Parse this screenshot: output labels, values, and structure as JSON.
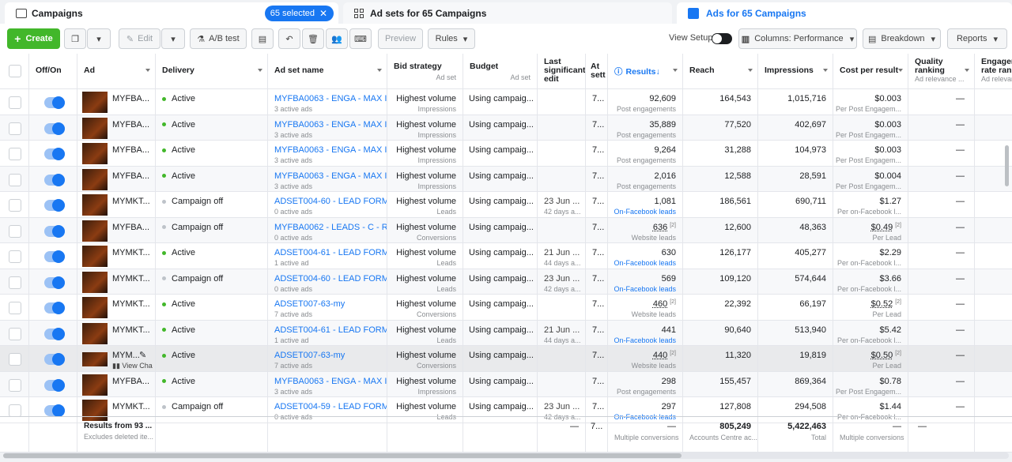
{
  "tabs": {
    "campaigns": "Campaigns",
    "selected_badge": "65 selected",
    "adsets": "Ad sets for 65 Campaigns",
    "ads": "Ads for 65 Campaigns"
  },
  "toolbar": {
    "create": "Create",
    "edit": "Edit",
    "ab_test": "A/B test",
    "preview": "Preview",
    "rules": "Rules",
    "view_setup": "View Setup",
    "columns": "Columns: Performance",
    "breakdown": "Breakdown",
    "reports": "Reports"
  },
  "headers": {
    "offon": "Off/On",
    "ad": "Ad",
    "delivery": "Delivery",
    "adset": "Ad set name",
    "bid": "Bid strategy",
    "bid_sub": "Ad set",
    "budget": "Budget",
    "budget_sub": "Ad set",
    "last1": "Last",
    "last2": "significant",
    "last3": "edit",
    "att1": "At",
    "att2": "sett",
    "results": "Results",
    "reach": "Reach",
    "impressions": "Impressions",
    "cpr": "Cost per result",
    "quality1": "Quality",
    "quality2": "ranking",
    "quality_sub": "Ad relevance ...",
    "eng1": "Engagem",
    "eng2": "rate rank",
    "eng_sub": "Ad relevan"
  },
  "rows": [
    {
      "ad": "MYFBA...",
      "delivery": "Active",
      "status": "active",
      "adset": "MYFBA0063 - ENGA - MAX I...",
      "adset_sub": "3 active ads",
      "bid": "Highest volume",
      "bid_sub": "Impressions",
      "budget": "Using campaig...",
      "edit": "",
      "edit_sub": "",
      "att": "7...",
      "results": "92,609",
      "results_sub": "Post engagements",
      "res_link": false,
      "res_u": false,
      "reach": "164,543",
      "impr": "1,015,716",
      "cpr": "$0.003",
      "cpr_sub": "Per Post Engagem...",
      "q": "—"
    },
    {
      "ad": "MYFBA...",
      "delivery": "Active",
      "status": "active",
      "adset": "MYFBA0063 - ENGA - MAX I...",
      "adset_sub": "3 active ads",
      "bid": "Highest volume",
      "bid_sub": "Impressions",
      "budget": "Using campaig...",
      "edit": "",
      "edit_sub": "",
      "att": "7...",
      "results": "35,889",
      "results_sub": "Post engagements",
      "res_link": false,
      "res_u": false,
      "reach": "77,520",
      "impr": "402,697",
      "cpr": "$0.003",
      "cpr_sub": "Per Post Engagem...",
      "q": "—"
    },
    {
      "ad": "MYFBA...",
      "delivery": "Active",
      "status": "active",
      "adset": "MYFBA0063 - ENGA - MAX I...",
      "adset_sub": "3 active ads",
      "bid": "Highest volume",
      "bid_sub": "Impressions",
      "budget": "Using campaig...",
      "edit": "",
      "edit_sub": "",
      "att": "7...",
      "results": "9,264",
      "results_sub": "Post engagements",
      "res_link": false,
      "res_u": false,
      "reach": "31,288",
      "impr": "104,973",
      "cpr": "$0.003",
      "cpr_sub": "Per Post Engagem...",
      "q": "—"
    },
    {
      "ad": "MYFBA...",
      "delivery": "Active",
      "status": "active",
      "adset": "MYFBA0063 - ENGA - MAX I...",
      "adset_sub": "3 active ads",
      "bid": "Highest volume",
      "bid_sub": "Impressions",
      "budget": "Using campaig...",
      "edit": "",
      "edit_sub": "",
      "att": "7...",
      "results": "2,016",
      "results_sub": "Post engagements",
      "res_link": false,
      "res_u": false,
      "reach": "12,588",
      "impr": "28,591",
      "cpr": "$0.004",
      "cpr_sub": "Per Post Engagem...",
      "q": "—"
    },
    {
      "ad": "MYMKT...",
      "delivery": "Campaign off",
      "status": "off",
      "adset": "ADSET004-60 - LEAD FORM ...",
      "adset_sub": "0 active ads",
      "bid": "Highest volume",
      "bid_sub": "Leads",
      "budget": "Using campaig...",
      "edit": "23 Jun ...",
      "edit_sub": "42 days a...",
      "att": "7...",
      "results": "1,081",
      "results_sub": "On-Facebook leads",
      "res_link": true,
      "res_u": false,
      "reach": "186,561",
      "impr": "690,711",
      "cpr": "$1.27",
      "cpr_sub": "Per on-Facebook l...",
      "q": "—"
    },
    {
      "ad": "MYFBA...",
      "delivery": "Campaign off",
      "status": "off",
      "adset": "MYFBA0062 - LEADS - C - RE...",
      "adset_sub": "0 active ads",
      "bid": "Highest volume",
      "bid_sub": "Conversions",
      "budget": "Using campaig...",
      "edit": "",
      "edit_sub": "",
      "att": "7...",
      "results": "636",
      "results_sub": "Website leads",
      "res_link": false,
      "res_u": true,
      "reach": "12,600",
      "impr": "48,363",
      "cpr": "$0.49",
      "cpr_sub": "Per Lead",
      "q": "—"
    },
    {
      "ad": "MYMKT...",
      "delivery": "Active",
      "status": "active",
      "adset": "ADSET004-61 - LEAD FORM ...",
      "adset_sub": "1 active ad",
      "bid": "Highest volume",
      "bid_sub": "Leads",
      "budget": "Using campaig...",
      "edit": "21 Jun ...",
      "edit_sub": "44 days a...",
      "att": "7...",
      "results": "630",
      "results_sub": "On-Facebook leads",
      "res_link": true,
      "res_u": false,
      "reach": "126,177",
      "impr": "405,277",
      "cpr": "$2.29",
      "cpr_sub": "Per on-Facebook l...",
      "q": "—"
    },
    {
      "ad": "MYMKT...",
      "delivery": "Campaign off",
      "status": "off",
      "adset": "ADSET004-60 - LEAD FORM ...",
      "adset_sub": "0 active ads",
      "bid": "Highest volume",
      "bid_sub": "Leads",
      "budget": "Using campaig...",
      "edit": "23 Jun ...",
      "edit_sub": "42 days a...",
      "att": "7...",
      "results": "569",
      "results_sub": "On-Facebook leads",
      "res_link": true,
      "res_u": false,
      "reach": "109,120",
      "impr": "574,644",
      "cpr": "$3.66",
      "cpr_sub": "Per on-Facebook l...",
      "q": "—"
    },
    {
      "ad": "MYMKT...",
      "delivery": "Active",
      "status": "active",
      "adset": "ADSET007-63-my",
      "adset_sub": "7 active ads",
      "bid": "Highest volume",
      "bid_sub": "Conversions",
      "budget": "Using campaig...",
      "edit": "",
      "edit_sub": "",
      "att": "7...",
      "results": "460",
      "results_sub": "Website leads",
      "res_link": false,
      "res_u": true,
      "reach": "22,392",
      "impr": "66,197",
      "cpr": "$0.52",
      "cpr_sub": "Per Lead",
      "q": "—"
    },
    {
      "ad": "MYMKT...",
      "delivery": "Active",
      "status": "active",
      "adset": "ADSET004-61 - LEAD FORM ...",
      "adset_sub": "1 active ad",
      "bid": "Highest volume",
      "bid_sub": "Leads",
      "budget": "Using campaig...",
      "edit": "21 Jun ...",
      "edit_sub": "44 days a...",
      "att": "7...",
      "results": "441",
      "results_sub": "On-Facebook leads",
      "res_link": true,
      "res_u": false,
      "reach": "90,640",
      "impr": "513,940",
      "cpr": "$5.42",
      "cpr_sub": "Per on-Facebook l...",
      "q": "—"
    },
    {
      "ad": "MYM...",
      "ad_sub": "View Cha",
      "delivery": "Active",
      "status": "active",
      "adset": "ADSET007-63-my",
      "adset_sub": "7 active ads",
      "bid": "Highest volume",
      "bid_sub": "Conversions",
      "budget": "Using campaig...",
      "edit": "",
      "edit_sub": "",
      "att": "7...",
      "results": "440",
      "results_sub": "Website leads",
      "res_link": false,
      "res_u": true,
      "reach": "11,320",
      "impr": "19,819",
      "cpr": "$0.50",
      "cpr_sub": "Per Lead",
      "q": "—",
      "hover": true
    },
    {
      "ad": "MYFBA...",
      "delivery": "Active",
      "status": "active",
      "adset": "MYFBA0063 - ENGA - MAX I...",
      "adset_sub": "3 active ads",
      "bid": "Highest volume",
      "bid_sub": "Impressions",
      "budget": "Using campaig...",
      "edit": "",
      "edit_sub": "",
      "att": "7...",
      "results": "298",
      "results_sub": "Post engagements",
      "res_link": false,
      "res_u": false,
      "reach": "155,457",
      "impr": "869,364",
      "cpr": "$0.78",
      "cpr_sub": "Per Post Engagem...",
      "q": "—"
    },
    {
      "ad": "MYMKT...",
      "delivery": "Campaign off",
      "status": "off",
      "adset": "ADSET004-59 - LEAD FORM ...",
      "adset_sub": "0 active ads",
      "bid": "Highest volume",
      "bid_sub": "Leads",
      "budget": "Using campaig...",
      "edit": "23 Jun ...",
      "edit_sub": "42 days a...",
      "att": "7...",
      "results": "297",
      "results_sub": "On-Facebook leads",
      "res_link": true,
      "res_u": false,
      "reach": "127,808",
      "impr": "294,508",
      "cpr": "$1.44",
      "cpr_sub": "Per on-Facebook l...",
      "q": "—"
    }
  ],
  "totals": {
    "label": "Results from 93 ...",
    "label_sub": "Excludes deleted ite...",
    "edit": "—",
    "att": "7...",
    "results": "—",
    "results_sub": "Multiple conversions",
    "reach": "805,249",
    "reach_sub": "Accounts Centre ac...",
    "impr": "5,422,463",
    "impr_sub": "Total",
    "cpr": "—",
    "cpr_sub": "Multiple conversions",
    "q": "—"
  }
}
